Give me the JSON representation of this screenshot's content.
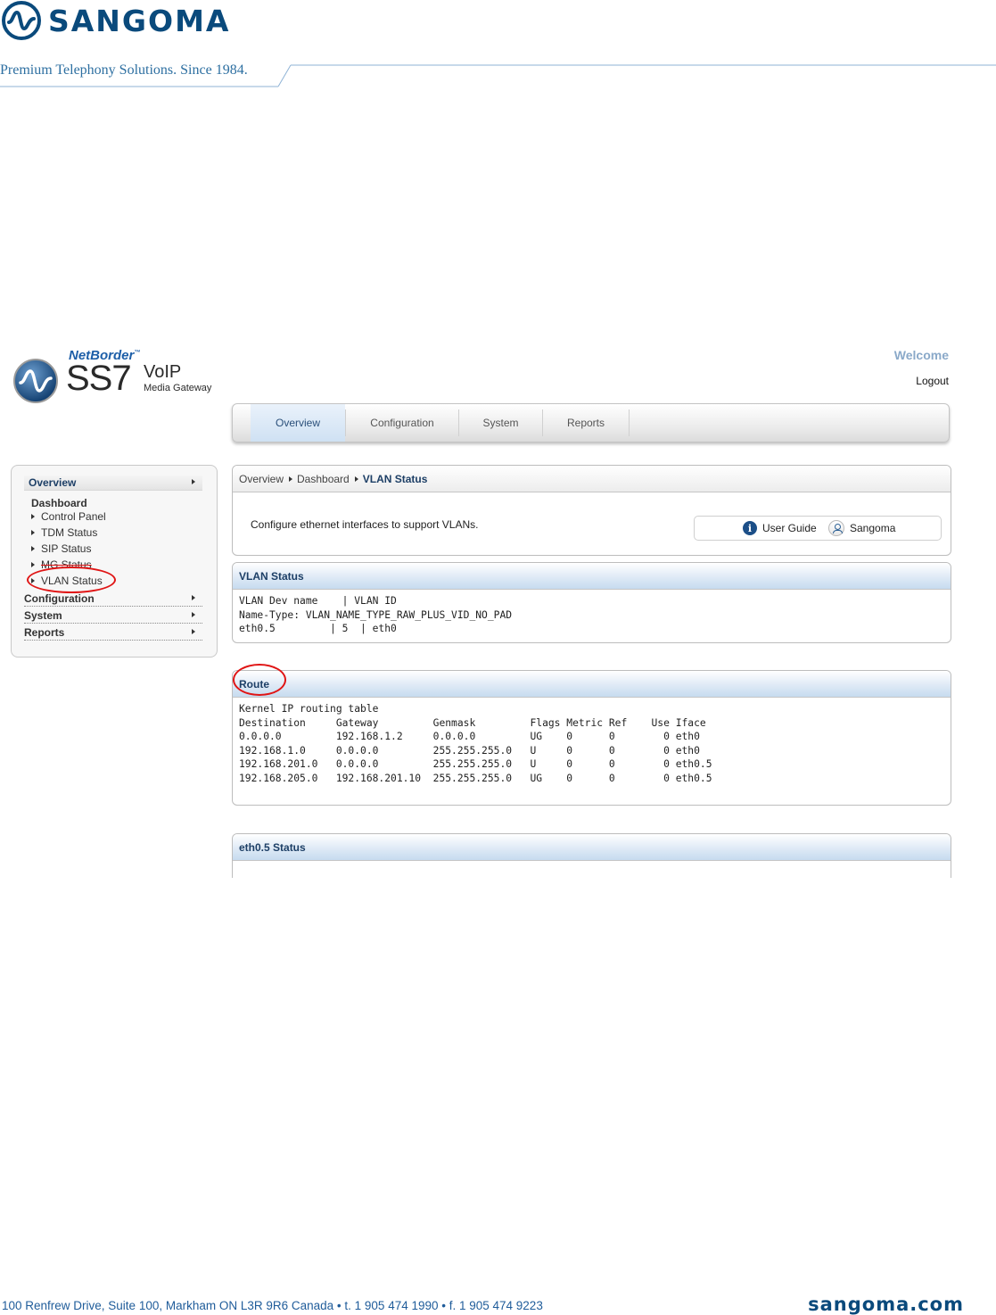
{
  "document": {
    "brand": "SANGOMA",
    "tagline": "Premium Telephony Solutions. Since 1984.",
    "footer_address": "100 Renfrew Drive, Suite 100, Markham ON L3R 9R6 Canada  •  t. 1 905 474 1990  •  f. 1 905 474 9223",
    "footer_site": "sangoma.com"
  },
  "app": {
    "logo": {
      "netborder": "NetBorder",
      "ss7": "SS7",
      "voip": "VoIP",
      "subtitle": "Media Gateway"
    },
    "welcome": "Welcome",
    "logout": "Logout",
    "tabs": [
      {
        "label": "Overview",
        "active": true
      },
      {
        "label": "Configuration",
        "active": false
      },
      {
        "label": "System",
        "active": false
      },
      {
        "label": "Reports",
        "active": false
      }
    ],
    "sidebar": {
      "overview": "Overview",
      "dashboard": "Dashboard",
      "items": [
        {
          "label": "Control Panel"
        },
        {
          "label": "TDM Status"
        },
        {
          "label": "SIP Status"
        },
        {
          "label": "MG Status"
        },
        {
          "label": "VLAN Status"
        }
      ],
      "configuration": "Configuration",
      "system": "System",
      "reports": "Reports"
    },
    "breadcrumb": [
      "Overview",
      "Dashboard",
      "VLAN Status"
    ],
    "description": "Configure ethernet interfaces to support VLANs.",
    "help": {
      "user_guide": "User Guide",
      "sangoma": "Sangoma",
      "info_glyph": "i"
    },
    "vlan_panel": {
      "title": "VLAN Status",
      "lines": [
        "VLAN Dev name    | VLAN ID",
        "Name-Type: VLAN_NAME_TYPE_RAW_PLUS_VID_NO_PAD",
        "eth0.5         | 5  | eth0"
      ]
    },
    "route_panel": {
      "title": "Route",
      "lines": [
        "Kernel IP routing table",
        "Destination     Gateway         Genmask         Flags Metric Ref    Use Iface",
        "0.0.0.0         192.168.1.2     0.0.0.0         UG    0      0        0 eth0",
        "192.168.1.0     0.0.0.0         255.255.255.0   U     0      0        0 eth0",
        "192.168.201.0   0.0.0.0         255.255.255.0   U     0      0        0 eth0.5",
        "192.168.205.0   192.168.201.10  255.255.255.0   UG    0      0        0 eth0.5"
      ]
    },
    "eth_panel": {
      "title": "eth0.5 Status"
    },
    "highlight_color": "#e01515"
  }
}
